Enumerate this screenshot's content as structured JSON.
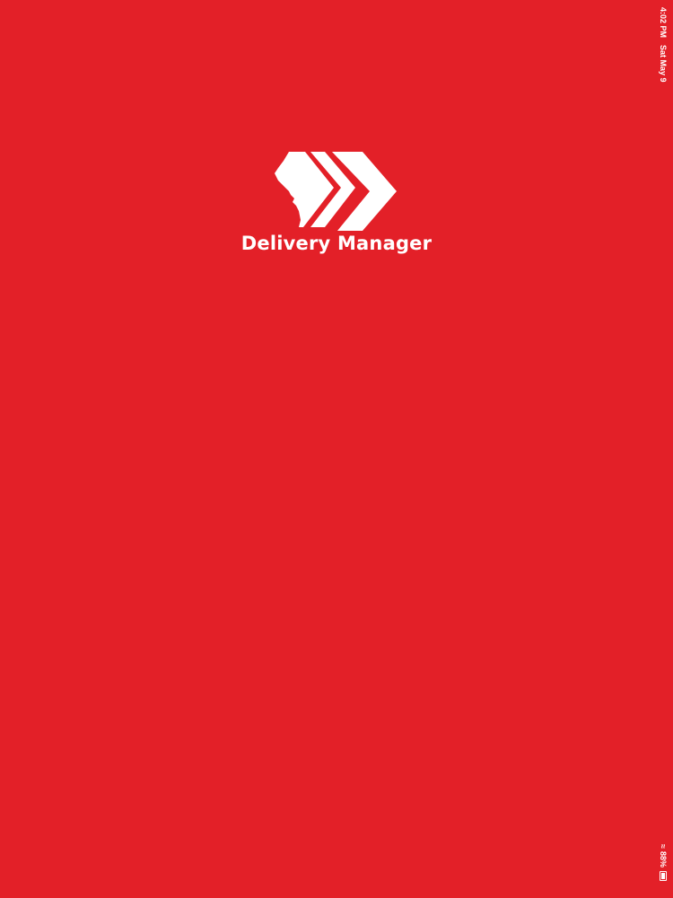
{
  "colors": {
    "background": "#E32028",
    "foreground": "#FFFFFF"
  },
  "status_bar": {
    "time": "4:02 PM",
    "date": "Sat May 9",
    "battery_percent": "88%",
    "battery_icon": "battery-icon",
    "wifi_icon": "wifi-icon"
  },
  "splash": {
    "logo_icon": "delivery-chevrons-logo",
    "title": "Delivery Manager"
  }
}
